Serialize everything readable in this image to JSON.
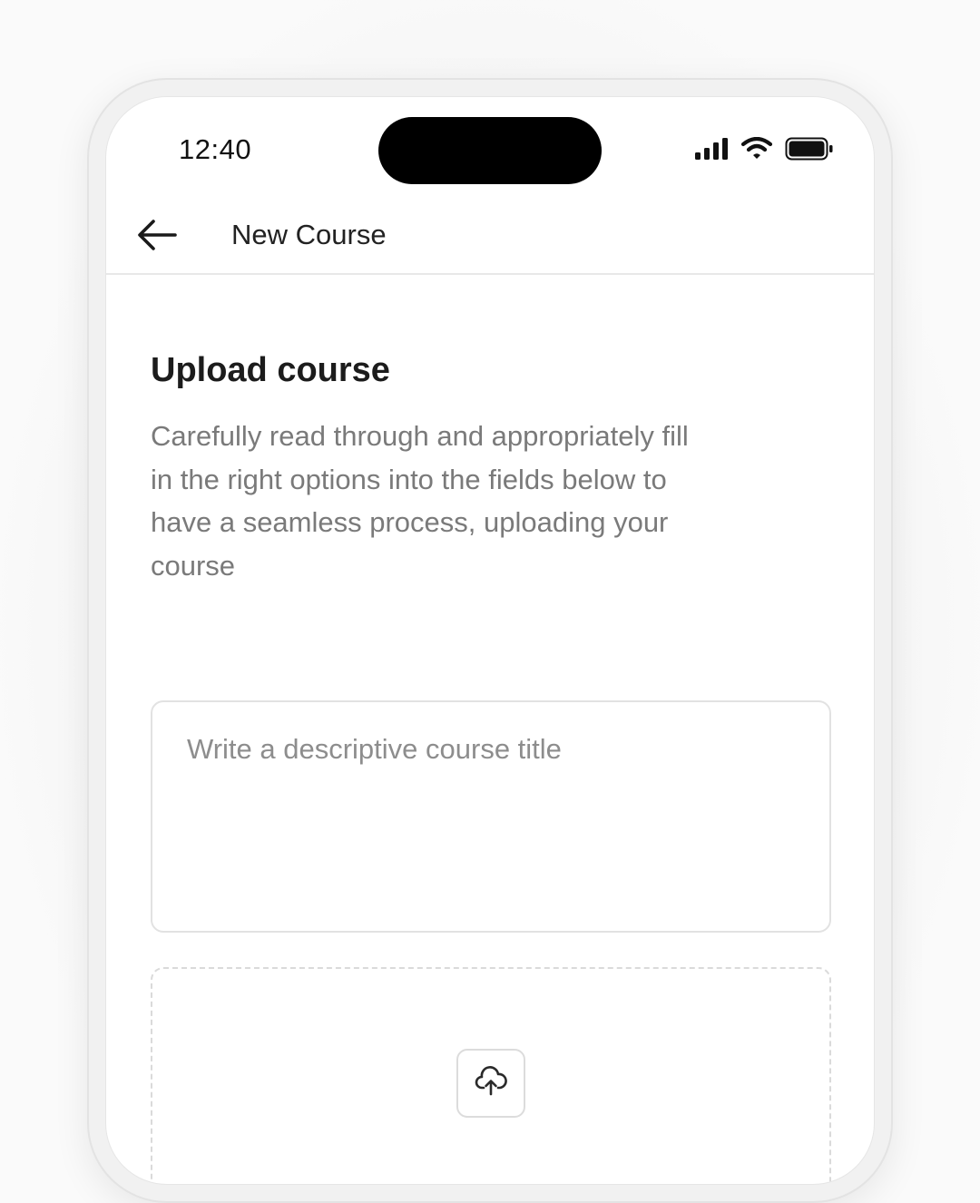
{
  "status_bar": {
    "time": "12:40",
    "icons": [
      "cellular-signal-icon",
      "wifi-icon",
      "battery-icon"
    ]
  },
  "header": {
    "back_icon": "arrow-left-icon",
    "title": "New Course"
  },
  "main": {
    "heading": "Upload course",
    "description": "Carefully read through and appropriately fill in the right options into the fields below to have a seamless process, uploading your course",
    "course_title_field": {
      "value": "",
      "placeholder": "Write a descriptive course title"
    },
    "upload_zone": {
      "icon": "cloud-upload-icon"
    }
  },
  "colors": {
    "background": "#ffffff",
    "heading_text": "#1c1c1c",
    "body_text": "#7a7a7a",
    "border": "#e2e2e2",
    "dynamic_island": "#000000"
  }
}
